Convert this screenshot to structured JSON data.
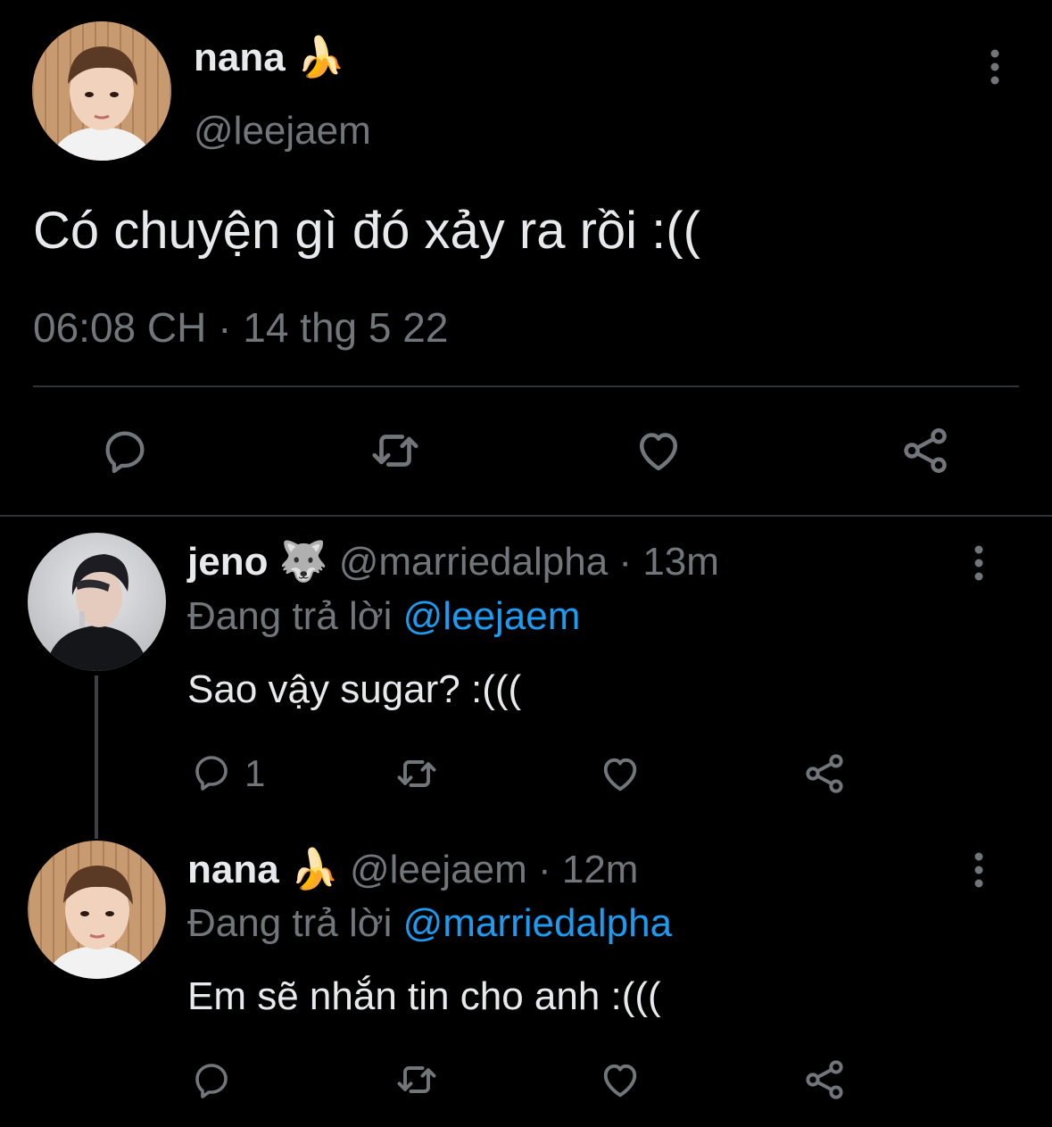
{
  "main_tweet": {
    "display_name": "nana",
    "name_emoji": "🍌",
    "handle": "@leejaem",
    "text": "Có chuyện gì đó xảy ra rồi :((",
    "time": "06:08 CH",
    "sep": "·",
    "date": "14 thg 5 22",
    "more_icon": "more-vertical-icon",
    "actions": [
      "reply-icon",
      "retweet-icon",
      "like-icon",
      "share-icon"
    ]
  },
  "replies": [
    {
      "display_name": "jeno",
      "name_emoji": "🐺",
      "handle": "@marriedalpha",
      "sep": "·",
      "age": "13m",
      "replying_prefix": "Đang trả lời",
      "replying_to": "@leejaem",
      "text": "Sao vậy sugar? :(((",
      "reply_count": "1"
    },
    {
      "display_name": "nana",
      "name_emoji": "🍌",
      "handle": "@leejaem",
      "sep": "·",
      "age": "12m",
      "replying_prefix": "Đang trả lời",
      "replying_to": "@marriedalpha",
      "text": "Em sẽ nhắn tin cho anh :(((",
      "reply_count": ""
    }
  ],
  "colors": {
    "background": "#000000",
    "text": "#e7e9ea",
    "muted": "#71767b",
    "link": "#1d9bf0",
    "divider": "#2f3336"
  }
}
